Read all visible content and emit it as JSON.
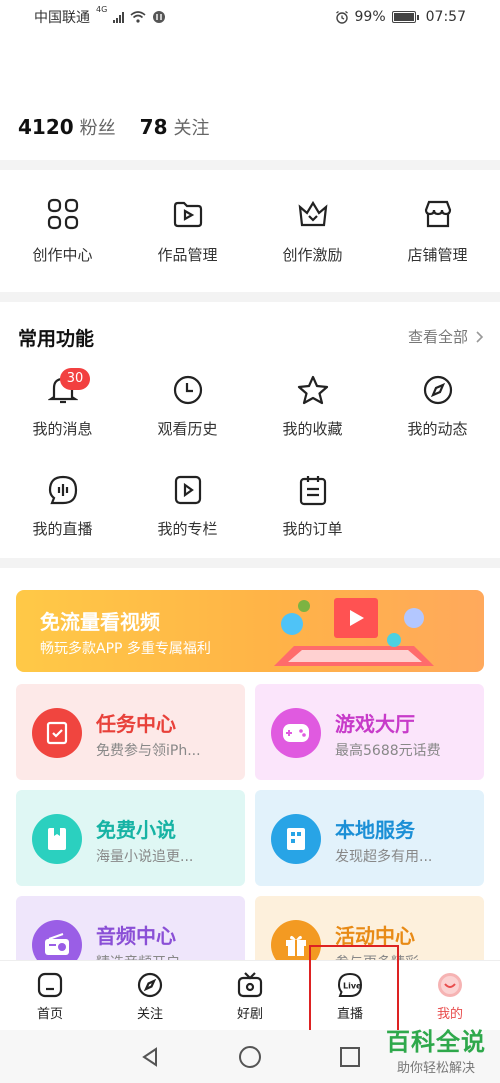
{
  "status_bar": {
    "carrier": "中国联通",
    "network": "4G",
    "battery": "99%",
    "time": "07:57"
  },
  "profile": {
    "fans_count": "4120",
    "fans_label": "粉丝",
    "follow_count": "78",
    "follow_label": "关注"
  },
  "creator_tools": [
    {
      "label": "创作中心",
      "icon": "grid-icon"
    },
    {
      "label": "作品管理",
      "icon": "folder-play-icon"
    },
    {
      "label": "创作激励",
      "icon": "crown-icon"
    },
    {
      "label": "店铺管理",
      "icon": "shop-icon"
    }
  ],
  "common": {
    "title": "常用功能",
    "see_all": "查看全部",
    "items": [
      {
        "label": "我的消息",
        "icon": "bell-icon",
        "badge": "30"
      },
      {
        "label": "观看历史",
        "icon": "clock-icon"
      },
      {
        "label": "我的收藏",
        "icon": "star-icon"
      },
      {
        "label": "我的动态",
        "icon": "compass-icon"
      },
      {
        "label": "我的直播",
        "icon": "live-wave-icon"
      },
      {
        "label": "我的专栏",
        "icon": "play-box-icon"
      },
      {
        "label": "我的订单",
        "icon": "order-icon"
      }
    ]
  },
  "banner": {
    "title": "免流量看视频",
    "subtitle": "畅玩多款APP 多重专属福利"
  },
  "cards": [
    {
      "title": "任务中心",
      "subtitle": "免费参与领iPh...",
      "title_color": "#e8413a",
      "bg": "#fde9e8",
      "icon_bg": "#f0453f",
      "icon": "task-icon"
    },
    {
      "title": "游戏大厅",
      "subtitle": "最高5688元话费",
      "title_color": "#c73bc9",
      "bg": "#fbe5fb",
      "icon_bg": "#e05ae0",
      "icon": "gamepad-icon"
    },
    {
      "title": "免费小说",
      "subtitle": "海量小说追更...",
      "title_color": "#16b3a4",
      "bg": "#dff7f4",
      "icon_bg": "#2bd0bf",
      "icon": "book-icon"
    },
    {
      "title": "本地服务",
      "subtitle": "发现超多有用...",
      "title_color": "#1b8fd6",
      "bg": "#e2f2fb",
      "icon_bg": "#28a4e6",
      "icon": "building-icon"
    },
    {
      "title": "音频中心",
      "subtitle": "精选音频开启...",
      "title_color": "#8a4fd6",
      "bg": "#efe6fb",
      "icon_bg": "#9a5ee6",
      "icon": "radio-icon"
    },
    {
      "title": "活动中心",
      "subtitle": "参与更多精彩...",
      "title_color": "#e88a15",
      "bg": "#fdf0dc",
      "icon_bg": "#f39a22",
      "icon": "gift-icon"
    }
  ],
  "bottom_nav": [
    {
      "label": "首页",
      "icon": "home-icon"
    },
    {
      "label": "关注",
      "icon": "compass-icon"
    },
    {
      "label": "好剧",
      "icon": "tv-icon"
    },
    {
      "label": "直播",
      "icon": "live-icon"
    },
    {
      "label": "我的",
      "icon": "avatar-icon",
      "active": true
    }
  ],
  "watermark": {
    "title": "百科全说",
    "subtitle": "助你轻松解决"
  }
}
